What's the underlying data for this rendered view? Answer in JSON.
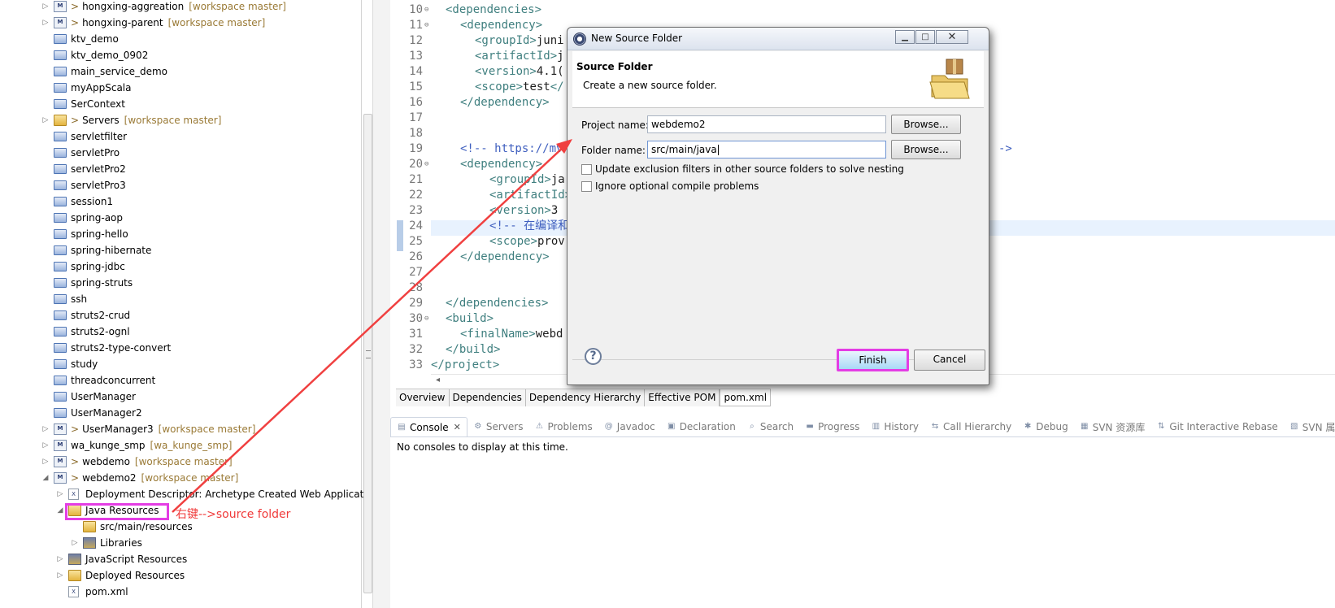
{
  "explorer": {
    "items": [
      {
        "label": "hongxing-aggreation",
        "prefix": ">",
        "ws": "[workspace master]",
        "icon": "maven",
        "arrow": "▷"
      },
      {
        "label": "hongxing-parent",
        "prefix": ">",
        "ws": "[workspace master]",
        "icon": "maven",
        "arrow": "▷"
      },
      {
        "label": "ktv_demo",
        "icon": "folder"
      },
      {
        "label": "ktv_demo_0902",
        "icon": "folder"
      },
      {
        "label": "main_service_demo",
        "icon": "folder"
      },
      {
        "label": "myAppScala",
        "icon": "folder"
      },
      {
        "label": "SerContext",
        "icon": "folder"
      },
      {
        "label": "Servers",
        "prefix": ">",
        "ws": "[workspace master]",
        "icon": "pkgfolder",
        "arrow": "▷"
      },
      {
        "label": "servletfilter",
        "icon": "folder"
      },
      {
        "label": "servletPro",
        "icon": "folder"
      },
      {
        "label": "servletPro2",
        "icon": "folder"
      },
      {
        "label": "servletPro3",
        "icon": "folder"
      },
      {
        "label": "session1",
        "icon": "folder"
      },
      {
        "label": "spring-aop",
        "icon": "folder"
      },
      {
        "label": "spring-hello",
        "icon": "folder"
      },
      {
        "label": "spring-hibernate",
        "icon": "folder"
      },
      {
        "label": "spring-jdbc",
        "icon": "folder"
      },
      {
        "label": "spring-struts",
        "icon": "folder"
      },
      {
        "label": "ssh",
        "icon": "folder"
      },
      {
        "label": "struts2-crud",
        "icon": "folder"
      },
      {
        "label": "struts2-ognl",
        "icon": "folder"
      },
      {
        "label": "struts2-type-convert",
        "icon": "folder"
      },
      {
        "label": "study",
        "icon": "folder"
      },
      {
        "label": "threadconcurrent",
        "icon": "folder"
      },
      {
        "label": "UserManager",
        "icon": "folder"
      },
      {
        "label": "UserManager2",
        "icon": "folder"
      },
      {
        "label": "UserManager3",
        "prefix": ">",
        "ws": "[workspace master]",
        "icon": "maven",
        "arrow": "▷"
      },
      {
        "label": "wa_kunge_smp",
        "ws": "[wa_kunge_smp]",
        "icon": "maven",
        "arrow": "▷"
      },
      {
        "label": "webdemo",
        "prefix": ">",
        "ws": "[workspace master]",
        "icon": "maven",
        "arrow": "▷"
      },
      {
        "label": "webdemo2",
        "prefix": ">",
        "ws": "[workspace master]",
        "icon": "maven",
        "arrow": "◢"
      },
      {
        "label": "Deployment Descriptor: Archetype Created Web Applicatio",
        "icon": "file",
        "arrow": "▷",
        "indent": 1
      },
      {
        "label": "Java Resources",
        "icon": "pkgfolder",
        "arrow": "◢",
        "indent": 1
      },
      {
        "label": "src/main/resources",
        "icon": "pkgfolder",
        "indent": 2
      },
      {
        "label": "Libraries",
        "icon": "lib",
        "arrow": "▷",
        "indent": 2
      },
      {
        "label": "JavaScript Resources",
        "icon": "lib",
        "arrow": "▷",
        "indent": 1
      },
      {
        "label": "Deployed Resources",
        "icon": "pkgfolder",
        "arrow": "▷",
        "indent": 1
      },
      {
        "label": "pom.xml",
        "icon": "file",
        "indent": 1
      }
    ],
    "annotation": "右键-->source folder"
  },
  "editor": {
    "lines": [
      {
        "n": "10",
        "fold": "⊖",
        "html": "<span class='tag'>&lt;dependencies&gt;</span>",
        "indent": 1
      },
      {
        "n": "11",
        "fold": "⊖",
        "html": "<span class='tag'>&lt;dependency&gt;</span>",
        "indent": 2
      },
      {
        "n": "12",
        "html": "<span class='tag'>&lt;groupId&gt;</span>juni",
        "indent": 3
      },
      {
        "n": "13",
        "html": "<span class='tag'>&lt;artifactId&gt;</span>j",
        "indent": 3
      },
      {
        "n": "14",
        "html": "<span class='tag'>&lt;version&gt;</span>4.1(",
        "indent": 3
      },
      {
        "n": "15",
        "html": "<span class='tag'>&lt;scope&gt;</span>test<span class='tag'>&lt;/</span>",
        "indent": 3
      },
      {
        "n": "16",
        "html": "<span class='tag'>&lt;/dependency&gt;</span>",
        "indent": 2
      },
      {
        "n": "17",
        "html": "",
        "indent": 0
      },
      {
        "n": "18",
        "html": "",
        "indent": 0
      },
      {
        "n": "19",
        "html": "<span class='cmt'>&lt;!-- https://mv</span>",
        "indent": 2
      },
      {
        "n": "20",
        "fold": "⊖",
        "html": "<span class='tag'>&lt;dependency&gt;</span>",
        "indent": 2
      },
      {
        "n": "21",
        "html": "<span class='tag'>&lt;groupId&gt;</span>ja",
        "indent": 4
      },
      {
        "n": "22",
        "html": "<span class='tag'>&lt;artifactId&gt;</span>",
        "indent": 4
      },
      {
        "n": "23",
        "html": "<span class='tag'>&lt;version&gt;</span>3",
        "indent": 4
      },
      {
        "n": "24",
        "html": "<span class='cmt'>&lt;!-- 在编译和</span>",
        "indent": 4
      },
      {
        "n": "25",
        "html": "<span class='tag'>&lt;scope&gt;</span>prov",
        "indent": 4
      },
      {
        "n": "26",
        "html": "<span class='tag'>&lt;/dependency&gt;</span>",
        "indent": 2
      },
      {
        "n": "27",
        "html": "",
        "indent": 0
      },
      {
        "n": "28",
        "html": "",
        "indent": 0
      },
      {
        "n": "29",
        "html": "<span class='tag'>&lt;/dependencies&gt;</span>",
        "indent": 1
      },
      {
        "n": "30",
        "fold": "⊖",
        "html": "<span class='tag'>&lt;build&gt;</span>",
        "indent": 1
      },
      {
        "n": "31",
        "html": "<span class='tag'>&lt;finalName&gt;</span>webd",
        "indent": 2
      },
      {
        "n": "32",
        "html": "<span class='tag'>&lt;/build&gt;</span>",
        "indent": 1
      },
      {
        "n": "33",
        "html": "<span class='tag'>&lt;/project&gt;</span>",
        "indent": 0
      }
    ],
    "line19_tail": "->",
    "tabs": [
      "Overview",
      "Dependencies",
      "Dependency Hierarchy",
      "Effective POM",
      "pom.xml"
    ],
    "active_tab": "pom.xml"
  },
  "console": {
    "tabs": [
      {
        "label": "Console",
        "icon": "console-icon",
        "glyph": "▤",
        "active": true
      },
      {
        "label": "Servers",
        "icon": "servers-icon",
        "glyph": "⚙"
      },
      {
        "label": "Problems",
        "icon": "problems-icon",
        "glyph": "⚠"
      },
      {
        "label": "Javadoc",
        "icon": "javadoc-icon",
        "glyph": "@"
      },
      {
        "label": "Declaration",
        "icon": "declaration-icon",
        "glyph": "▣"
      },
      {
        "label": "Search",
        "icon": "search-icon",
        "glyph": "⌕"
      },
      {
        "label": "Progress",
        "icon": "progress-icon",
        "glyph": "▬"
      },
      {
        "label": "History",
        "icon": "history-icon",
        "glyph": "▥"
      },
      {
        "label": "Call Hierarchy",
        "icon": "call-hierarchy-icon",
        "glyph": "⇆"
      },
      {
        "label": "Debug",
        "icon": "debug-icon",
        "glyph": "✱"
      },
      {
        "label": "SVN 资源库",
        "icon": "svn-repo-icon",
        "glyph": "▦"
      },
      {
        "label": "Git Interactive Rebase",
        "icon": "git-rebase-icon",
        "glyph": "⇅"
      },
      {
        "label": "SVN 属性",
        "icon": "svn-props-icon",
        "glyph": "▧"
      }
    ],
    "close_glyph": "✕",
    "message": "No consoles to display at this time."
  },
  "dialog": {
    "title": "New Source Folder",
    "header_title": "Source Folder",
    "header_desc": "Create a new source folder.",
    "project_label": "Project name:",
    "project_value": "webdemo2",
    "folder_label": "Folder name:",
    "folder_value": "src/main/java",
    "browse_label": "Browse...",
    "check1": "Update exclusion filters in other source folders to solve nesting",
    "check2": "Ignore optional compile problems",
    "finish_label": "Finish",
    "cancel_label": "Cancel",
    "help_glyph": "?",
    "min_glyph": "▁",
    "max_glyph": "□",
    "close_glyph": "✕"
  },
  "colors": {
    "highlight": "#e43de4",
    "annotation": "#f03a3a"
  }
}
